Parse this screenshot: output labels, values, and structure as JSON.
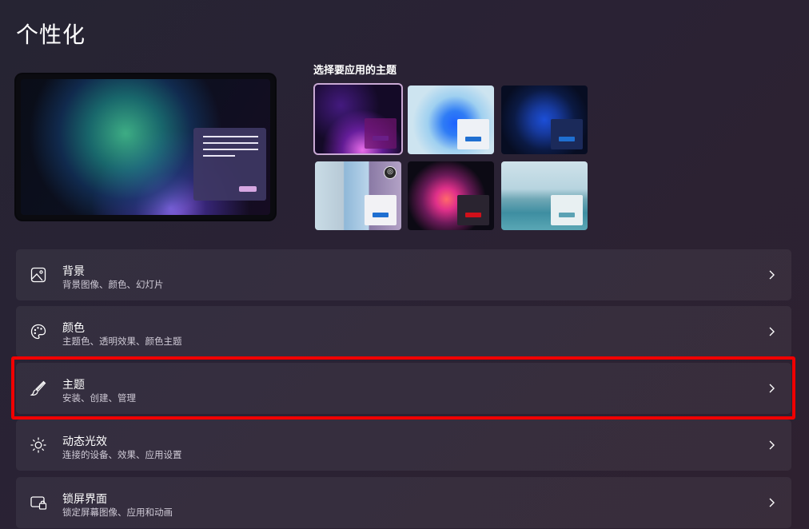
{
  "page": {
    "title": "个性化"
  },
  "themes": {
    "label": "选择要应用的主题",
    "items": [
      {
        "name": "theme-dark-glow",
        "accent": "#5b1a6e",
        "selected": true
      },
      {
        "name": "theme-blue-light",
        "accent": "#1f6fd1"
      },
      {
        "name": "theme-blue-dark",
        "accent": "#1f6fd1"
      },
      {
        "name": "theme-captured-motion",
        "accent": "#1f6fd1",
        "icon": "camera-icon"
      },
      {
        "name": "theme-flow",
        "accent": "#d0101a"
      },
      {
        "name": "theme-sunrise",
        "accent": "#5aa2b4"
      }
    ]
  },
  "settings": [
    {
      "title": "背景",
      "subtitle": "背景图像、颜色、幻灯片",
      "icon": "image-icon"
    },
    {
      "title": "颜色",
      "subtitle": "主题色、透明效果、颜色主题",
      "icon": "palette-icon"
    },
    {
      "title": "主题",
      "subtitle": "安装、创建、管理",
      "icon": "brush-icon"
    },
    {
      "title": "动态光效",
      "subtitle": "连接的设备、效果、应用设置",
      "icon": "sun-icon"
    },
    {
      "title": "锁屏界面",
      "subtitle": "锁定屏幕图像、应用和动画",
      "icon": "lock-screen-icon"
    }
  ],
  "colors": {
    "highlight": "#f00000",
    "selected_border": "#c9a9d4"
  }
}
